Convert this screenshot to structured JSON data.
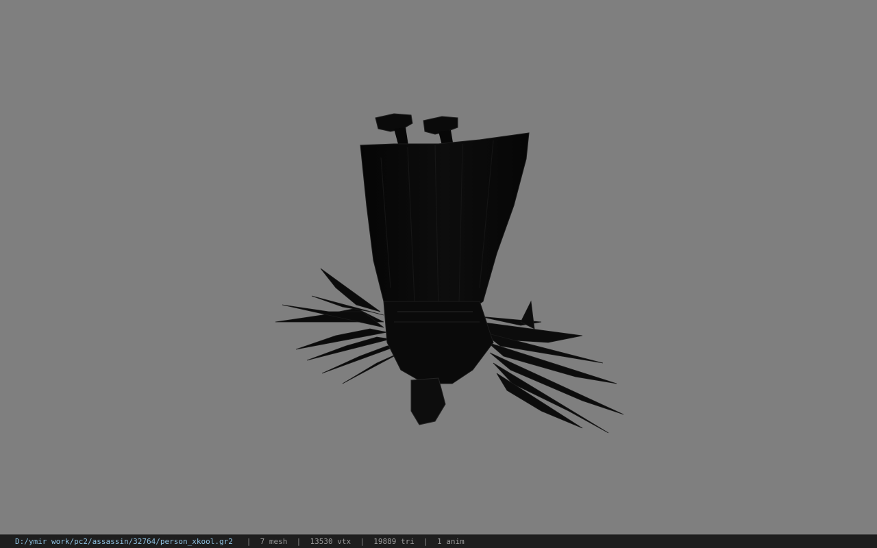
{
  "viewport": {
    "background_color": "#7f7f7f",
    "model_color": "#080808",
    "model_description_icon": "model-preview"
  },
  "statusbar": {
    "file_path": "D:/ymir work/pc2/assassin/32764/person_xkool.gr2",
    "mesh_count": "7 mesh",
    "vertex_count": "13530 vtx",
    "triangle_count": "19889 tri",
    "anim_count": "1 anim",
    "separator": "|",
    "path_color": "#8fc1e0"
  }
}
